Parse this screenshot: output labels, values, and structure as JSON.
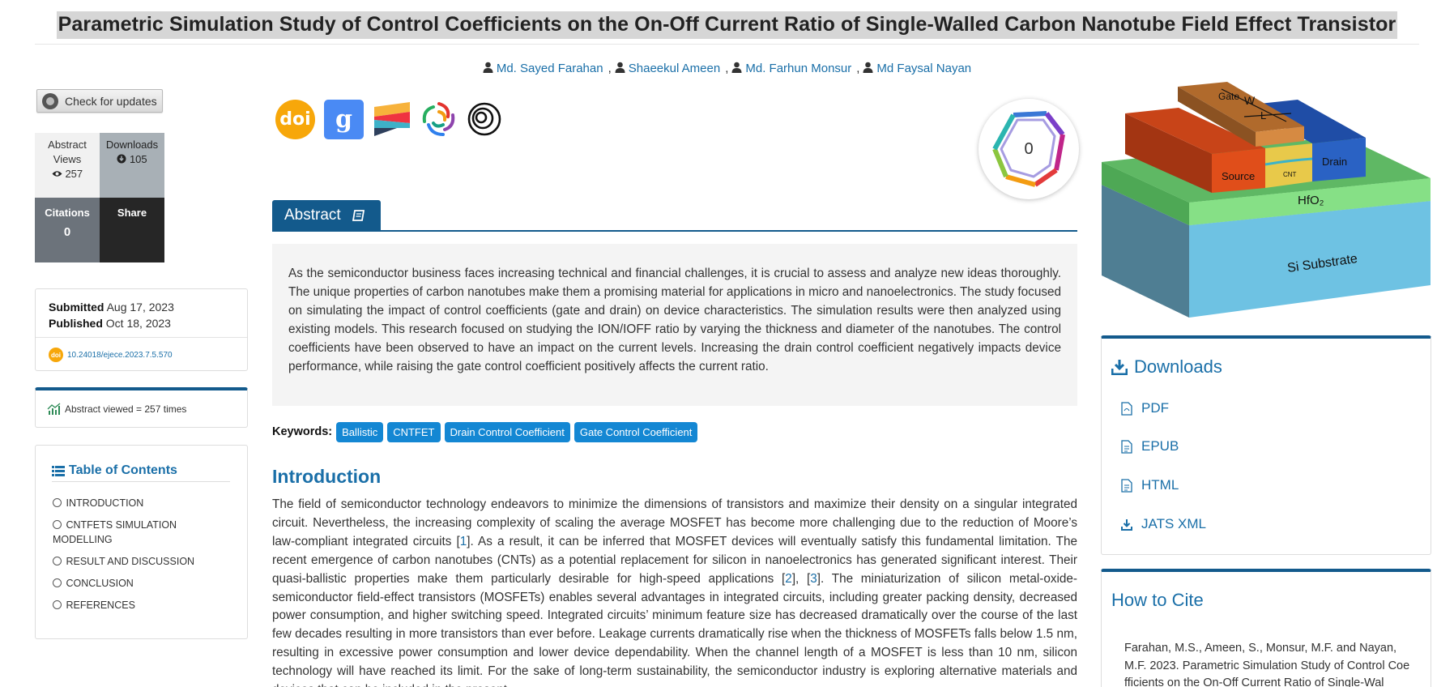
{
  "title": "Parametric Simulation Study of Control Coefficients on the On-Off Current Ratio of Single-Walled Carbon Nanotube Field Effect Transistor",
  "authors": [
    "Md. Sayed Farahan",
    "Shaeekul Ameen",
    "Md. Farhun Monsur",
    "Md Faysal Nayan"
  ],
  "author_sep": ",",
  "check_updates": "Check for updates",
  "stats": {
    "views_label": "Abstract Views",
    "views_value": "257",
    "downloads_label": "Downloads",
    "downloads_value": "105",
    "citations_label": "Citations",
    "citations_value": "0",
    "share_label": "Share"
  },
  "dates": {
    "submitted_label": "Submitted",
    "submitted_value": "Aug 17, 2023",
    "published_label": "Published",
    "published_value": "Oct 18, 2023",
    "doi": "10.24018/ejece.2023.7.5.570",
    "doi_badge": "doi"
  },
  "abstract_viewed": "Abstract viewed = 257 times",
  "toc": {
    "title": "Table of Contents",
    "items": [
      "INTRODUCTION",
      "CNTFETS SIMULATION MODELLING",
      "RESULT AND DISCUSSION",
      "CONCLUSION",
      "REFERENCES"
    ]
  },
  "badges": {
    "doi": "doi",
    "scholar": "g"
  },
  "dimensions_count": "0",
  "abstract": {
    "tab_label": "Abstract",
    "text": "As the semiconductor business faces increasing technical and financial challenges, it is crucial to assess and analyze new ideas thoroughly. The unique properties of carbon nanotubes make them a promising material for applications in micro and nanoelectronics. The study focused on simulating the impact of control coefficients (gate and drain) on device characteristics. The simulation results were then analyzed using existing models. This research focused on studying the ION/IOFF ratio by varying the thickness and diameter of the nanotubes. The control coefficients have been observed to have an impact on the current levels. Increasing the drain control coefficient negatively impacts device performance, while raising the gate control coefficient positively affects the current ratio."
  },
  "keywords": {
    "label": "Keywords:",
    "items": [
      "Ballistic",
      "CNTFET",
      "Drain Control Coefficient",
      "Gate Control Coefficient"
    ]
  },
  "intro": {
    "heading": "Introduction",
    "p1": "The field of semiconductor technology endeavors to minimize the dimensions of transistors and maximize their density on a singular integrated circuit. Nevertheless, the increasing complexity of scaling the average MOSFET has become more challenging due to the reduction of Moore’s law-compliant integrated circuits [",
    "ref1": "1",
    "p2": "]. As a result, it can be inferred that MOSFET devices will eventually satisfy this fundamental limitation. The recent emergence of carbon nanotubes (CNTs) as a potential replacement for silicon in nanoelectronics has generated significant interest. Their quasi-ballistic properties make them particularly desirable for high-speed applications [",
    "ref2": "2",
    "p3": "], [",
    "ref3": "3",
    "p4": "]. The miniaturization of silicon metal-oxide-semiconductor field-effect transistors (MOSFETs) enables several advantages in integrated circuits, including greater packing density, decreased power consumption, and higher switching speed. Integrated circuits’ minimum feature size has decreased dramatically over the course of the last few decades resulting in more transistors than ever before. Leakage currents dramatically rise when the thickness of MOSFETs falls below 1.5 nm, resulting in excessive power consumption and lower device dependability. When the channel length of a MOSFET is less than 10 nm, silicon technology will have reached its limit. For the sake of long-term sustainability, the semiconductor industry is exploring alternative materials and devices that can be included in the present"
  },
  "device_labels": {
    "gate": "Gate",
    "w": "W",
    "l": "L",
    "source": "Source",
    "cnt": "CNT",
    "drain": "Drain",
    "hfo2": "HfO₂",
    "substrate": "Si Substrate"
  },
  "downloads": {
    "title": "Downloads",
    "items": [
      "PDF",
      "EPUB",
      "HTML",
      "JATS XML"
    ]
  },
  "cite": {
    "title": "How to Cite",
    "text": "Farahan, M.S., Ameen, S., Monsur, M.F. and Nayan, M.F. 2023. Parametric Simulation Study of Control Coefficients on the On-Off Current Ratio of Single-Wal"
  }
}
